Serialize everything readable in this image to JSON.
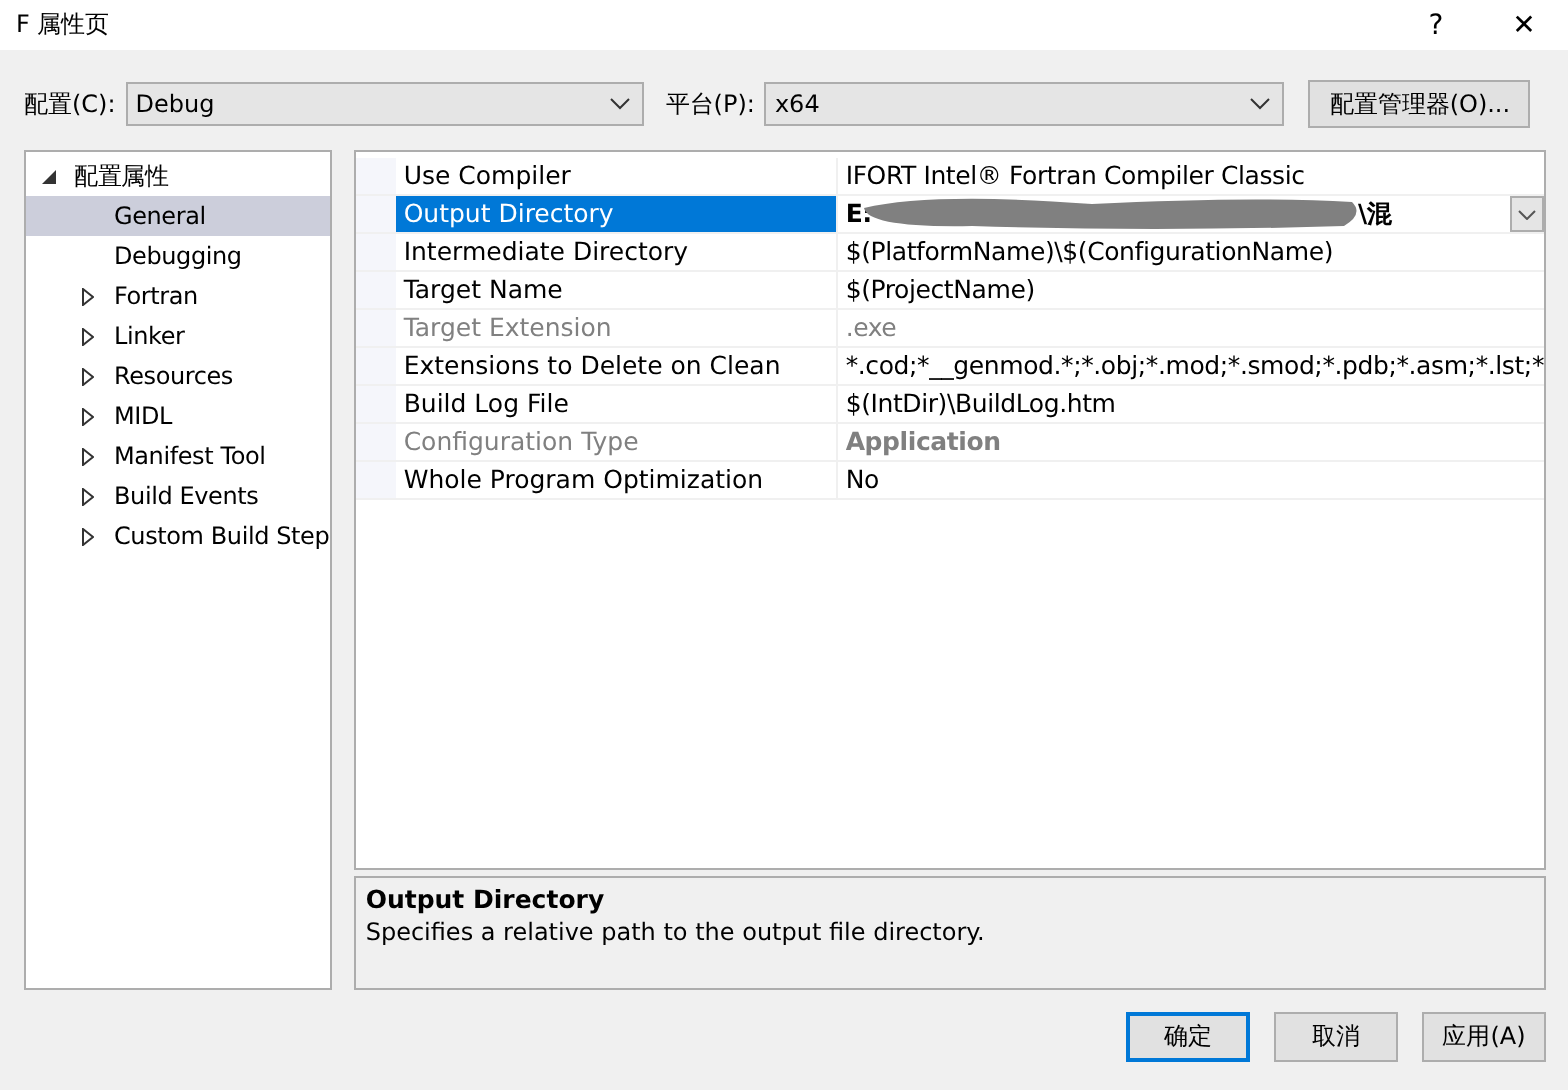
{
  "window": {
    "title": "F 属性页",
    "help": "?",
    "close": "✕"
  },
  "config": {
    "label": "配置(C):",
    "value": "Debug"
  },
  "platform": {
    "label": "平台(P):",
    "value": "x64"
  },
  "manager_button": "配置管理器(O)...",
  "tree": [
    {
      "label": "配置属性",
      "expanded": true,
      "selected": false,
      "children": [
        {
          "label": "General",
          "selected": true
        },
        {
          "label": "Debugging",
          "selected": false
        },
        {
          "label": "Fortran",
          "expanded": false,
          "selected": false
        },
        {
          "label": "Linker",
          "expanded": false,
          "selected": false
        },
        {
          "label": "Resources",
          "expanded": false,
          "selected": false
        },
        {
          "label": "MIDL",
          "expanded": false,
          "selected": false
        },
        {
          "label": "Manifest Tool",
          "expanded": false,
          "selected": false
        },
        {
          "label": "Build Events",
          "expanded": false,
          "selected": false
        },
        {
          "label": "Custom Build Step",
          "expanded": false,
          "selected": false
        }
      ]
    }
  ],
  "properties": [
    {
      "name": "Use Compiler",
      "value": "IFORT Intel® Fortran Compiler Classic",
      "selected": false,
      "disabled": false,
      "modified": false
    },
    {
      "name": "Output Directory",
      "value": "E:",
      "value_end": "\\混",
      "redacted": true,
      "dropdown": true,
      "selected": true,
      "disabled": false,
      "modified": true
    },
    {
      "name": "Intermediate Directory",
      "value": "$(PlatformName)\\$(ConfigurationName)",
      "selected": false,
      "disabled": false,
      "modified": false
    },
    {
      "name": "Target Name",
      "value": "$(ProjectName)",
      "selected": false,
      "disabled": false,
      "modified": false
    },
    {
      "name": "Target Extension",
      "value": ".exe",
      "selected": false,
      "disabled": true,
      "modified": false
    },
    {
      "name": "Extensions to Delete on Clean",
      "value": "*.cod;*__genmod.*;*.obj;*.mod;*.smod;*.pdb;*.asm;*.lst;*",
      "selected": false,
      "disabled": false,
      "modified": false
    },
    {
      "name": "Build Log File",
      "value": "$(IntDir)\\BuildLog.htm",
      "selected": false,
      "disabled": false,
      "modified": false
    },
    {
      "name": "Configuration Type",
      "value": "Application",
      "selected": false,
      "disabled": true,
      "modified": true
    },
    {
      "name": "Whole Program Optimization",
      "value": "No",
      "selected": false,
      "disabled": false,
      "modified": false
    }
  ],
  "description": {
    "title": "Output Directory",
    "text": "Specifies a relative path to the output file directory."
  },
  "buttons": [
    {
      "label": "确定",
      "default": true
    },
    {
      "label": "取消",
      "default": false
    },
    {
      "label": "应用(A)",
      "default": false
    }
  ]
}
